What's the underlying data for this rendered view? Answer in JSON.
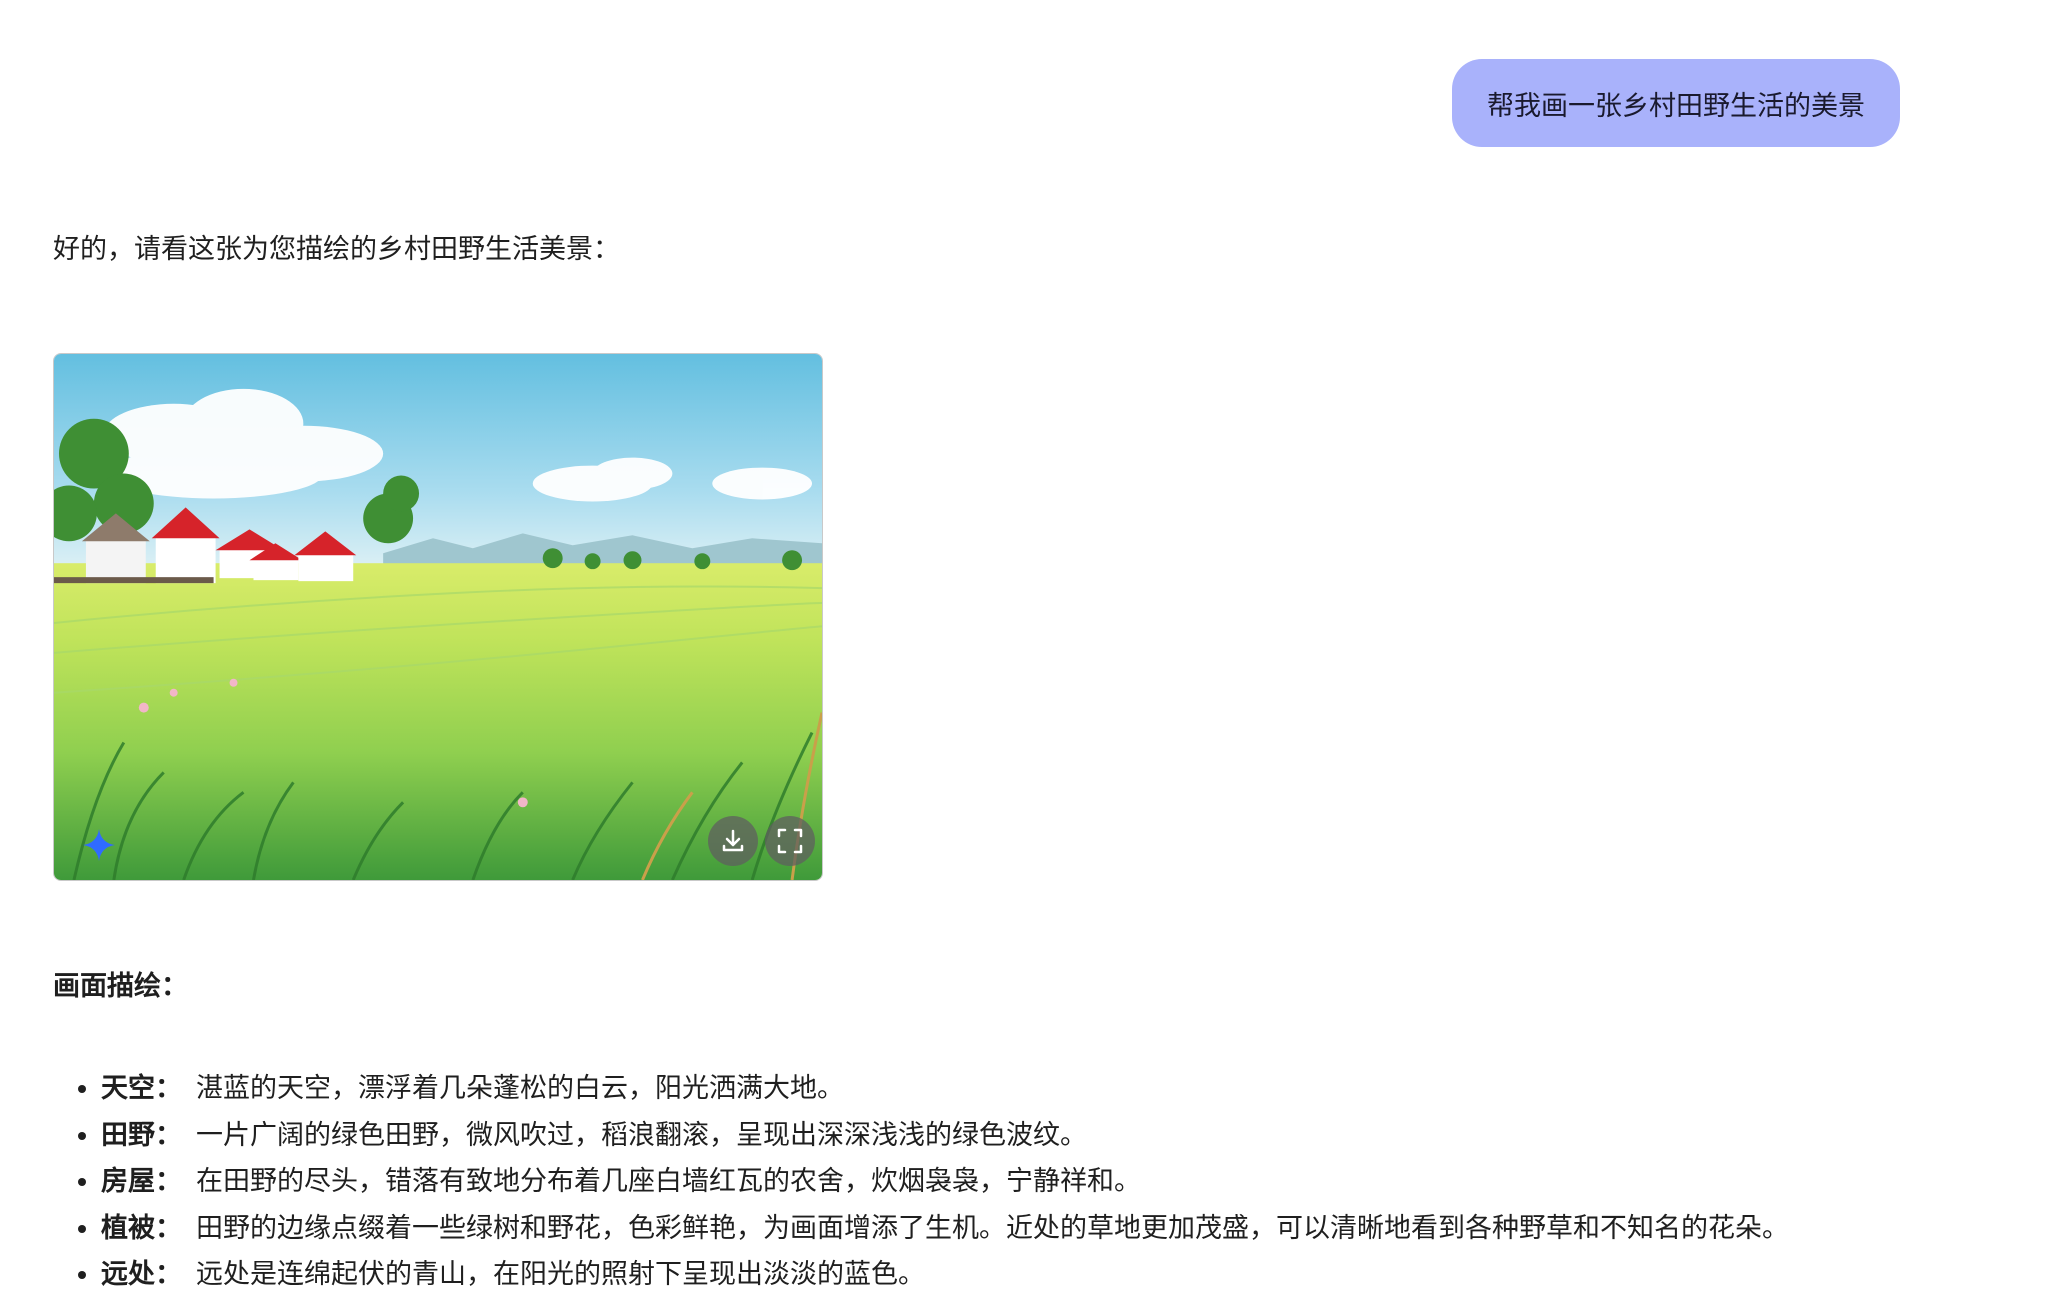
{
  "chat": {
    "user_message": "帮我画一张乡村田野生活的美景",
    "assistant_intro": "好的，请看这张为您描绘的乡村田野生活美景：",
    "image": {
      "alt": "乡村田野生活美景",
      "buttons": {
        "download": "download-icon",
        "fullscreen": "fullscreen-icon"
      },
      "badge": "sparkle-icon"
    },
    "section_heading": "画面描绘：",
    "details": [
      {
        "term": "天空：",
        "text": "湛蓝的天空，漂浮着几朵蓬松的白云，阳光洒满大地。"
      },
      {
        "term": "田野：",
        "text": "一片广阔的绿色田野，微风吹过，稻浪翻滚，呈现出深深浅浅的绿色波纹。"
      },
      {
        "term": "房屋：",
        "text": "在田野的尽头，错落有致地分布着几座白墙红瓦的农舍，炊烟袅袅，宁静祥和。"
      },
      {
        "term": "植被：",
        "text": "田野的边缘点缀着一些绿树和野花，色彩鲜艳，为画面增添了生机。近处的草地更加茂盛，可以清晰地看到各种野草和不知名的花朵。"
      },
      {
        "term": "远处：",
        "text": "远处是连绵起伏的青山，在阳光的照射下呈现出淡淡的蓝色。"
      }
    ]
  },
  "colors": {
    "user_bubble": "#a9b2fb",
    "sky_top": "#67c1e0",
    "field_green": "#8fd14a",
    "roof_red": "#d6232a",
    "sparkle_blue": "#2f6bff"
  }
}
